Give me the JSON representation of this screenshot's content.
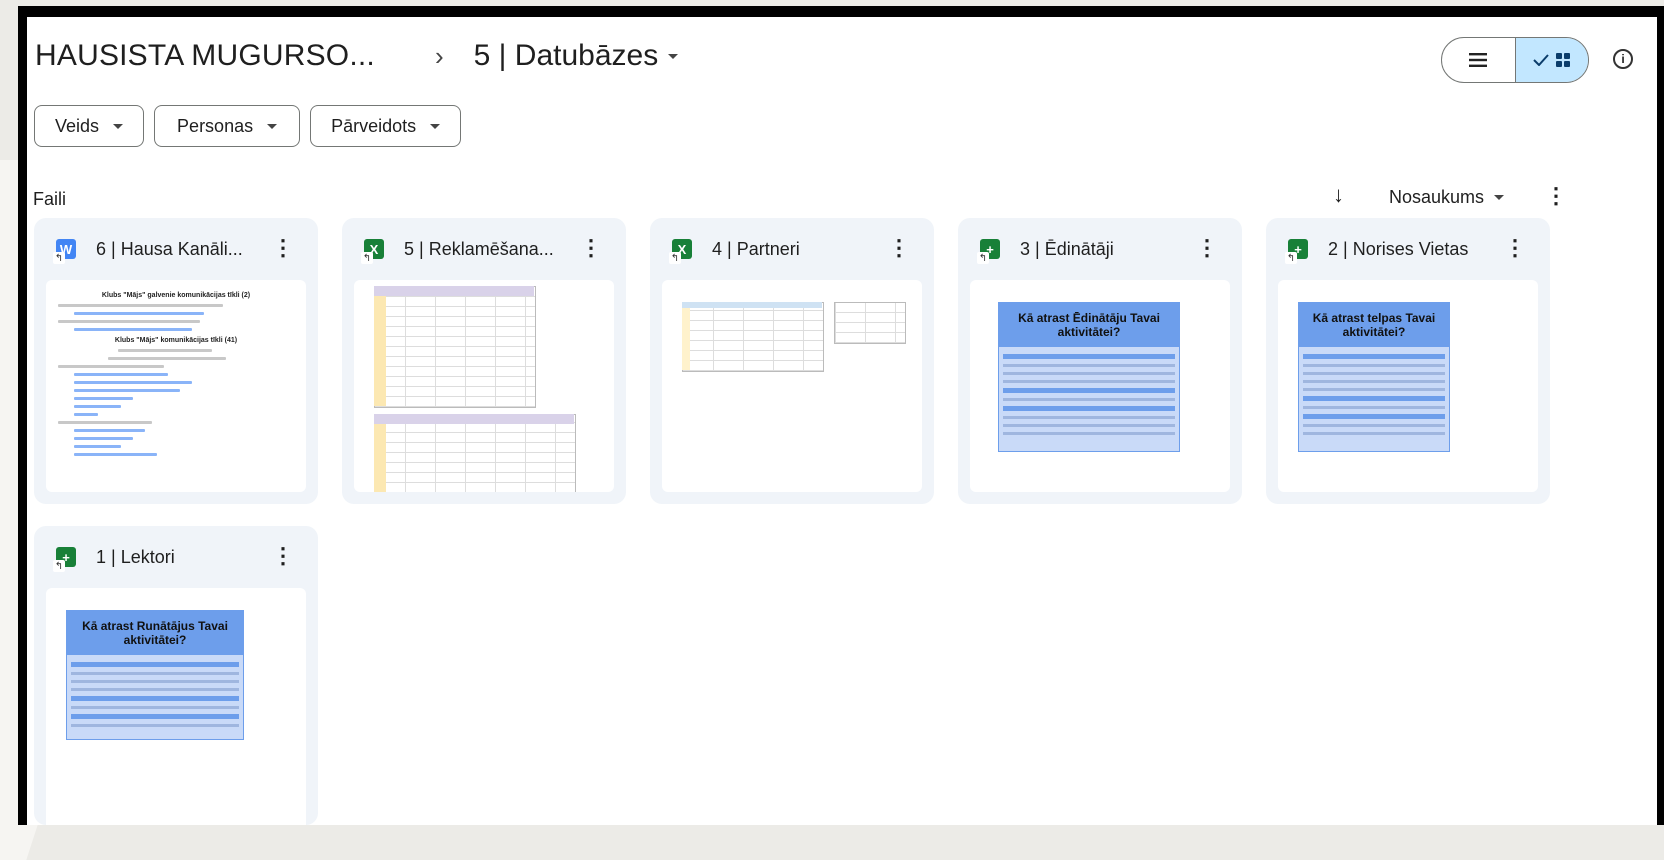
{
  "breadcrumb": {
    "root": "HAUSISTA MUGURSO...",
    "separator": "›",
    "current": "5 | Datubāzes"
  },
  "header": {
    "view_list_icon": "list-icon",
    "view_grid_icon": "grid-icon",
    "info_icon": "info-icon"
  },
  "filters": [
    {
      "label": "Veids"
    },
    {
      "label": "Personas"
    },
    {
      "label": "Pārveidots"
    }
  ],
  "section": {
    "label": "Faili"
  },
  "sort": {
    "arrow": "↓",
    "label": "Nosaukums"
  },
  "files": [
    {
      "title": "6 | Hausa Kanāli...",
      "type": "doc",
      "icon_letter": "W",
      "thumb_heading_1": "Klubs \"Mājs\" galvenie komunikācijas tīkli (2)",
      "thumb_heading_2": "Klubs \"Mājs\" komunikācijas tīkli (41)"
    },
    {
      "title": "5 | Reklamēšana...",
      "type": "xls",
      "icon_letter": "X"
    },
    {
      "title": "4 | Partneri",
      "type": "xls",
      "icon_letter": "X"
    },
    {
      "title": "3 | Ēdinātāji",
      "type": "sheet",
      "icon_letter": "+",
      "thumb_title": "Kā atrast Ēdinātāju Tavai aktivitātei?"
    },
    {
      "title": "2 | Norises Vietas",
      "type": "sheet",
      "icon_letter": "+",
      "thumb_title": "Kā atrast telpas Tavai aktivitātei?"
    },
    {
      "title": "1 | Lektori",
      "type": "sheet",
      "icon_letter": "+",
      "thumb_title": "Kā atrast Runātājus Tavai aktivitātei?"
    }
  ],
  "colors": {
    "doc_blue": "#4285f4",
    "sheet_green": "#188038",
    "selected_toggle": "#c2e7ff",
    "card_bg": "#f0f4f9"
  }
}
